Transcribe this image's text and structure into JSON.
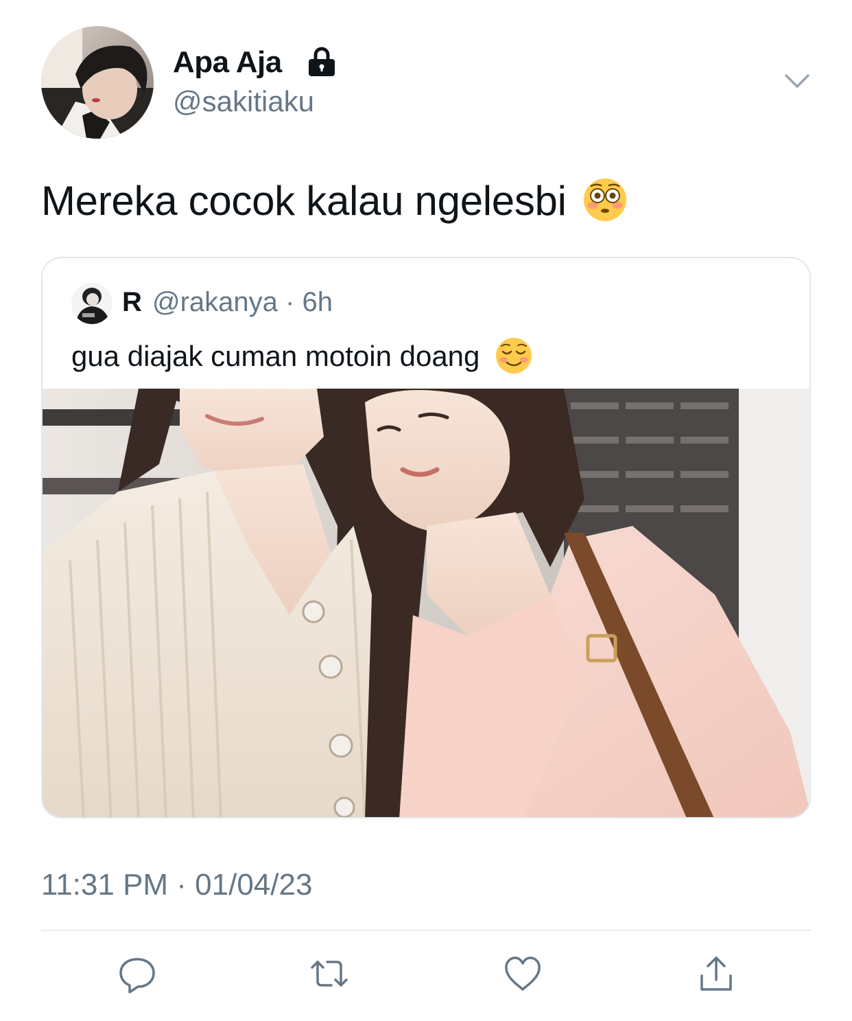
{
  "author": {
    "display_name": "Apa Aja",
    "handle": "@sakitiaku",
    "protected_icon": "lock-icon"
  },
  "tweet": {
    "text": "Mereka cocok kalau ngelesbi",
    "emoji": "flushed-face"
  },
  "quoted_tweet": {
    "name": "R",
    "handle": "@rakanya",
    "separator": "·",
    "time": "6h",
    "text": "gua diajak cuman motoin doang",
    "emoji": "smiling-face"
  },
  "timestamp": "11:31 PM · 01/04/23",
  "actions": [
    "reply-icon",
    "retweet-icon",
    "like-icon",
    "share-icon"
  ],
  "colors": {
    "text": "#0f1419",
    "secondary": "#657786",
    "border": "#e1e8ed",
    "icon": "#657786"
  }
}
